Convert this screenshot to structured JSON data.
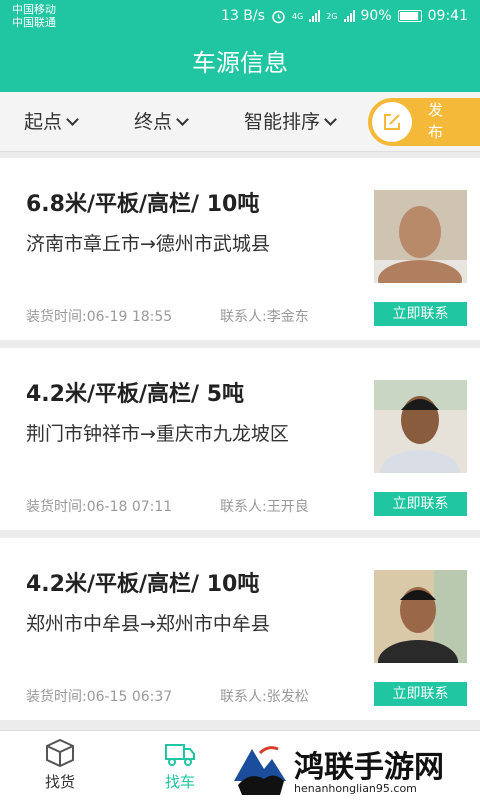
{
  "status": {
    "carrier1": "中国移动",
    "carrier2": "中国联通",
    "speed": "13 B/s",
    "net1": "4G",
    "net2": "2G",
    "battery": "90%",
    "time": "09:41"
  },
  "header": {
    "title": "车源信息"
  },
  "filters": {
    "origin": "起点",
    "destination": "终点",
    "sort": "智能排序",
    "publish": "发布"
  },
  "listings": [
    {
      "title": "6.8米/平板/高栏/ 10吨",
      "route": "济南市章丘市→德州市武城县",
      "load_time": "装货时间:06-19 18:55",
      "contact": "联系人:李金东",
      "button": "立即联系"
    },
    {
      "title": "4.2米/平板/高栏/ 5吨",
      "route": "荆门市钟祥市→重庆市九龙坡区",
      "load_time": "装货时间:06-18 07:11",
      "contact": "联系人:王开良",
      "button": "立即联系"
    },
    {
      "title": "4.2米/平板/高栏/ 10吨",
      "route": "郑州市中牟县→郑州市中牟县",
      "load_time": "装货时间:06-15 06:37",
      "contact": "联系人:张发松",
      "button": "立即联系"
    }
  ],
  "tabs": {
    "find_goods": "找货",
    "find_truck": "找车"
  },
  "watermark": {
    "text": "鸿联手游网",
    "url": "henanhonglian95.com"
  },
  "colors": {
    "primary": "#1fc6a1",
    "accent": "#f5b93a"
  }
}
